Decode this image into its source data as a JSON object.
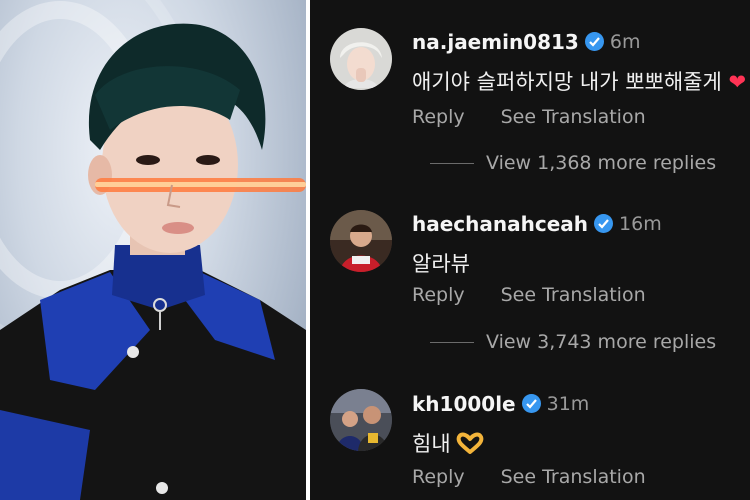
{
  "comments": [
    {
      "username": "na.jaemin0813",
      "time": "6m",
      "text": "애기야 슬퍼하지망 내가 뽀뽀해줄게",
      "reply_label": "Reply",
      "translation_label": "See Translation",
      "view_replies": "View 1,368 more replies"
    },
    {
      "username": "haechanahceah",
      "time": "16m",
      "text": "알라뷰",
      "reply_label": "Reply",
      "translation_label": "See Translation",
      "view_replies": "View 3,743 more replies"
    },
    {
      "username": "kh1000le",
      "time": "31m",
      "text": "힘내",
      "reply_label": "Reply",
      "translation_label": "See Translation"
    }
  ],
  "colors": {
    "background": "#121212",
    "verified": "#3797f0",
    "secondary_text": "#a8a8a8",
    "primary_text": "#f5f5f5"
  },
  "icons": [
    "verified-badge-icon",
    "heart-hands-emoji",
    "red-heart-emoji"
  ]
}
